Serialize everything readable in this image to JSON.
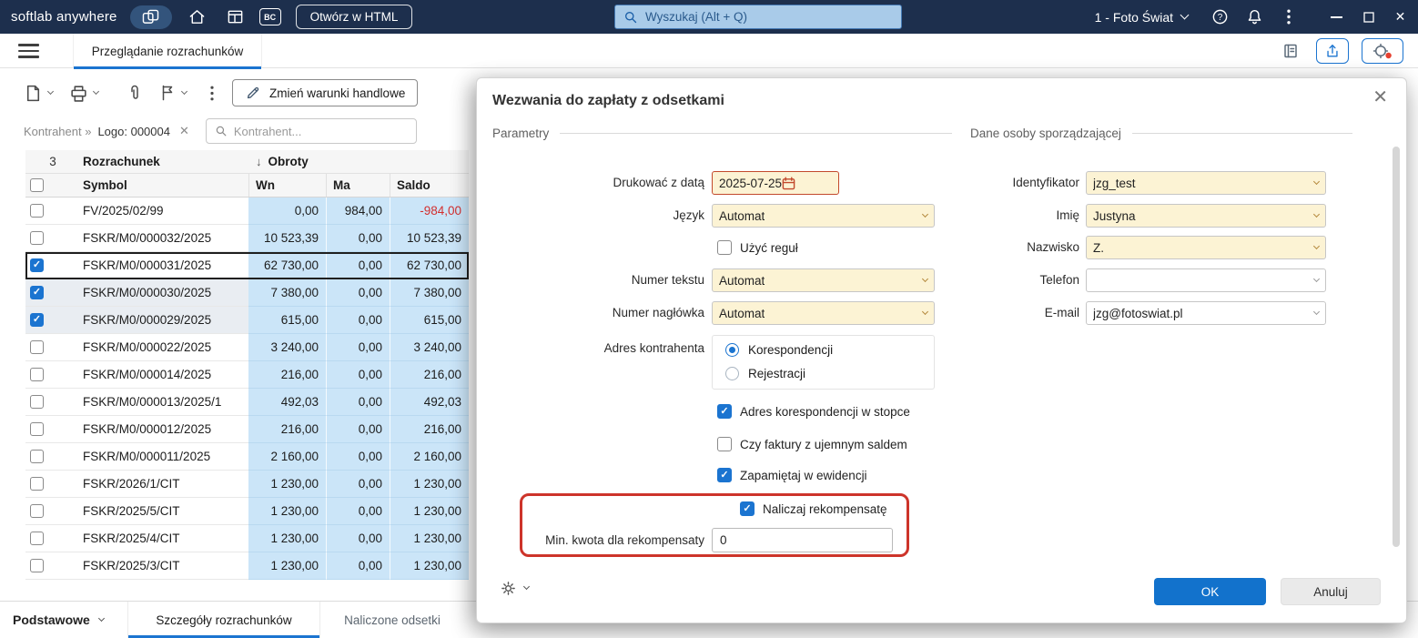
{
  "topbar": {
    "logo": "softlab anywhere",
    "bc_badge": "BC",
    "open_html": "Otwórz w HTML",
    "search_placeholder": "Wyszukaj (Alt + Q)",
    "company": "1 - Foto Świat"
  },
  "tabbar": {
    "tab": "Przeglądanie rozrachunków"
  },
  "toolbar": {
    "change_terms": "Zmień warunki handlowe"
  },
  "filter": {
    "chip_field": "Kontrahent »",
    "chip_value": "Logo: 000004",
    "search_placeholder": "Kontrahent..."
  },
  "table": {
    "selected_count": "3",
    "headers": {
      "rozrachunek": "Rozrachunek",
      "symbol": "Symbol",
      "obroty": "Obroty",
      "sort_arrow": "↓",
      "wn": "Wn",
      "ma": "Ma",
      "saldo": "Saldo"
    },
    "rows": [
      {
        "symbol": "FV/2025/02/99",
        "wn": "0,00",
        "ma": "984,00",
        "saldo": "-984,00",
        "checked": false,
        "focused": false,
        "negative": true
      },
      {
        "symbol": "FSKR/M0/000032/2025",
        "wn": "10 523,39",
        "ma": "0,00",
        "saldo": "10 523,39",
        "checked": false,
        "focused": false,
        "negative": false
      },
      {
        "symbol": "FSKR/M0/000031/2025",
        "wn": "62 730,00",
        "ma": "0,00",
        "saldo": "62 730,00",
        "checked": true,
        "focused": true,
        "negative": false
      },
      {
        "symbol": "FSKR/M0/000030/2025",
        "wn": "7 380,00",
        "ma": "0,00",
        "saldo": "7 380,00",
        "checked": true,
        "focused": false,
        "negative": false
      },
      {
        "symbol": "FSKR/M0/000029/2025",
        "wn": "615,00",
        "ma": "0,00",
        "saldo": "615,00",
        "checked": true,
        "focused": false,
        "negative": false
      },
      {
        "symbol": "FSKR/M0/000022/2025",
        "wn": "3 240,00",
        "ma": "0,00",
        "saldo": "3 240,00",
        "checked": false,
        "focused": false,
        "negative": false
      },
      {
        "symbol": "FSKR/M0/000014/2025",
        "wn": "216,00",
        "ma": "0,00",
        "saldo": "216,00",
        "checked": false,
        "focused": false,
        "negative": false
      },
      {
        "symbol": "FSKR/M0/000013/2025/1",
        "wn": "492,03",
        "ma": "0,00",
        "saldo": "492,03",
        "checked": false,
        "focused": false,
        "negative": false
      },
      {
        "symbol": "FSKR/M0/000012/2025",
        "wn": "216,00",
        "ma": "0,00",
        "saldo": "216,00",
        "checked": false,
        "focused": false,
        "negative": false
      },
      {
        "symbol": "FSKR/M0/000011/2025",
        "wn": "2 160,00",
        "ma": "0,00",
        "saldo": "2 160,00",
        "checked": false,
        "focused": false,
        "negative": false
      },
      {
        "symbol": "FSKR/2026/1/CIT",
        "wn": "1 230,00",
        "ma": "0,00",
        "saldo": "1 230,00",
        "checked": false,
        "focused": false,
        "negative": false
      },
      {
        "symbol": "FSKR/2025/5/CIT",
        "wn": "1 230,00",
        "ma": "0,00",
        "saldo": "1 230,00",
        "checked": false,
        "focused": false,
        "negative": false
      },
      {
        "symbol": "FSKR/2025/4/CIT",
        "wn": "1 230,00",
        "ma": "0,00",
        "saldo": "1 230,00",
        "checked": false,
        "focused": false,
        "negative": false
      },
      {
        "symbol": "FSKR/2025/3/CIT",
        "wn": "1 230,00",
        "ma": "0,00",
        "saldo": "1 230,00",
        "checked": false,
        "focused": false,
        "negative": false
      }
    ]
  },
  "bottombar": {
    "group": "Podstawowe",
    "tab_details": "Szczegóły rozrachunków",
    "tab_interest": "Naliczone odsetki"
  },
  "modal": {
    "title": "Wezwania do zapłaty z odsetkami",
    "section_params": "Parametry",
    "section_person": "Dane osoby sporządzającej",
    "date_label": "Drukować z datą",
    "date_value": "2025-07-25",
    "lang_label": "Język",
    "lang_value": "Automat",
    "use_rules": {
      "label": "Użyć reguł",
      "checked": false
    },
    "text_number_label": "Numer tekstu",
    "text_number_value": "Automat",
    "header_number_label": "Numer nagłówka",
    "header_number_value": "Automat",
    "address_label": "Adres kontrahenta",
    "address_options": [
      {
        "label": "Korespondencji",
        "selected": true
      },
      {
        "label": "Rejestracji",
        "selected": false
      }
    ],
    "checks": [
      {
        "label": "Adres korespondencji w stopce",
        "checked": true
      },
      {
        "label": "Czy faktury z ujemnym saldem",
        "checked": false
      },
      {
        "label": "Zapamiętaj w ewidencji",
        "checked": true
      },
      {
        "label": "Naliczaj rekompensatę",
        "checked": true
      }
    ],
    "min_amount_label": "Min. kwota dla rekompensaty",
    "min_amount_value": "0",
    "person_fields": [
      {
        "label": "Identyfikator",
        "value": "jzg_test"
      },
      {
        "label": "Imię",
        "value": "Justyna"
      },
      {
        "label": "Nazwisko",
        "value": "Z."
      },
      {
        "label": "Telefon",
        "value": ""
      },
      {
        "label": "E-mail",
        "value": "jzg@fotoswiat.pl"
      }
    ],
    "ok": "OK",
    "cancel": "Anuluj"
  },
  "colors": {
    "topbar_bg": "#1d2f4d",
    "accent_blue": "#1b74d0",
    "cell_blue": "#cbe5f8",
    "field_yellow": "#fcf3d4",
    "annotation_red": "#cd342a",
    "negative_red": "#d32f2f"
  }
}
